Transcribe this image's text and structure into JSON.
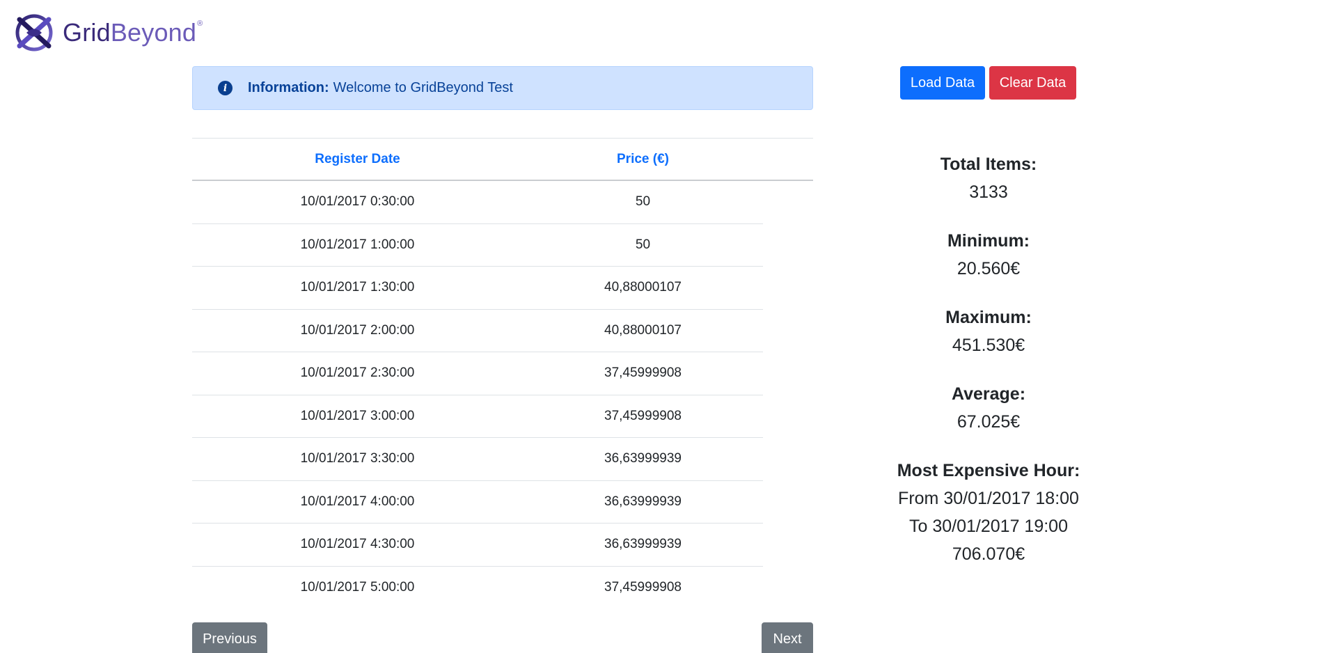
{
  "brand": {
    "name_part1": "Grid",
    "name_part2": "Beyond",
    "reg_mark": "®"
  },
  "alert": {
    "label": "Information:",
    "message": "Welcome to GridBeyond Test",
    "icon": "info-icon"
  },
  "table": {
    "headers": [
      "Register Date",
      "Price (€)"
    ],
    "rows": [
      [
        "10/01/2017 0:30:00",
        "50"
      ],
      [
        "10/01/2017 1:00:00",
        "50"
      ],
      [
        "10/01/2017 1:30:00",
        "40,88000107"
      ],
      [
        "10/01/2017 2:00:00",
        "40,88000107"
      ],
      [
        "10/01/2017 2:30:00",
        "37,45999908"
      ],
      [
        "10/01/2017 3:00:00",
        "37,45999908"
      ],
      [
        "10/01/2017 3:30:00",
        "36,63999939"
      ],
      [
        "10/01/2017 4:00:00",
        "36,63999939"
      ],
      [
        "10/01/2017 4:30:00",
        "36,63999939"
      ],
      [
        "10/01/2017 5:00:00",
        "37,45999908"
      ]
    ]
  },
  "pagination": {
    "previous": "Previous",
    "next": "Next"
  },
  "actions": {
    "load": "Load Data",
    "clear": "Clear Data"
  },
  "stats": {
    "total_label": "Total Items:",
    "total_value": "3133",
    "min_label": "Minimum:",
    "min_value": "20.560€",
    "max_label": "Maximum:",
    "max_value": "451.530€",
    "avg_label": "Average:",
    "avg_value": "67.025€",
    "expensive_label": "Most Expensive Hour:",
    "expensive_from": "From 30/01/2017 18:00",
    "expensive_to": "To 30/01/2017 19:00",
    "expensive_value": "706.070€"
  },
  "colors": {
    "primary": "#0d6efd",
    "danger": "#dc3545",
    "secondary": "#6c757d",
    "alert_bg": "#cfe2ff"
  }
}
